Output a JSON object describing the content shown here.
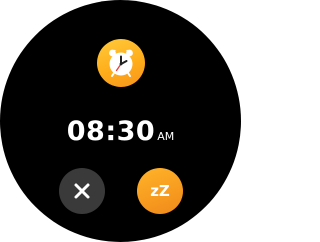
{
  "alarm": {
    "time": "08:30",
    "period": "AM"
  },
  "actions": {
    "dismiss_icon": "close-icon",
    "snooze_label": "zZ"
  },
  "icons": {
    "alarm": "alarm-clock-icon"
  },
  "colors": {
    "background": "#000000",
    "accent": "#f7a21f",
    "dismiss_button": "#3a3a3a",
    "text": "#ffffff"
  }
}
